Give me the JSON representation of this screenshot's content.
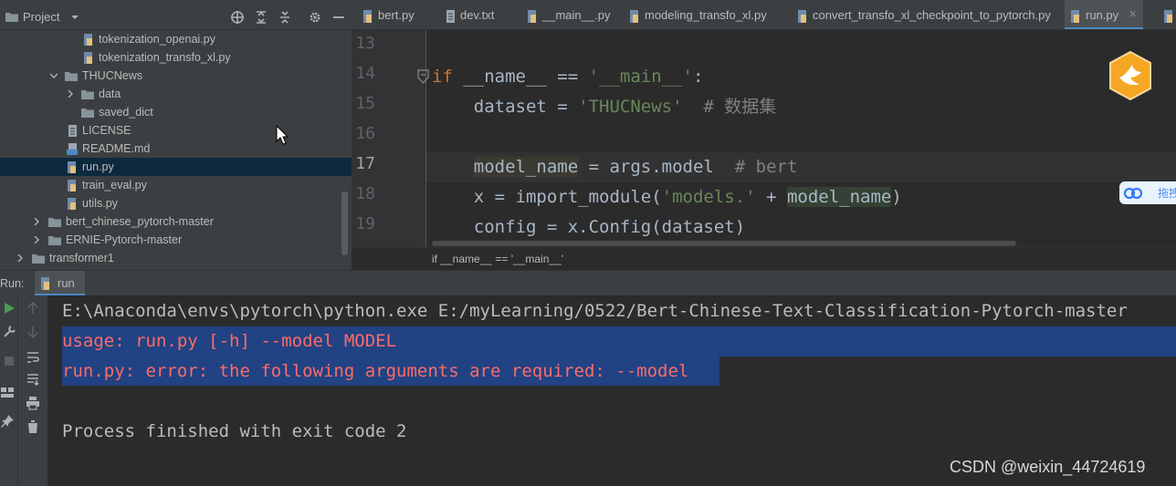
{
  "project": {
    "title": "Project",
    "tree": [
      {
        "label": "tokenization_openai.py",
        "icon": "python-file-icon",
        "selected": false
      },
      {
        "label": "tokenization_transfo_xl.py",
        "icon": "python-file-icon",
        "selected": false
      },
      {
        "label": "THUCNews",
        "icon": "folder-icon",
        "expanded": true
      },
      {
        "label": "data",
        "icon": "folder-icon",
        "expanded": false
      },
      {
        "label": "saved_dict",
        "icon": "folder-icon"
      },
      {
        "label": "LICENSE",
        "icon": "text-file-icon"
      },
      {
        "label": "README.md",
        "icon": "markdown-file-icon"
      },
      {
        "label": "run.py",
        "icon": "python-file-icon",
        "selected": true
      },
      {
        "label": "train_eval.py",
        "icon": "python-file-icon"
      },
      {
        "label": "utils.py",
        "icon": "python-file-icon"
      },
      {
        "label": "bert_chinese_pytorch-master",
        "icon": "folder-icon",
        "expanded": false
      },
      {
        "label": "ERNIE-Pytorch-master",
        "icon": "folder-icon",
        "expanded": false
      },
      {
        "label": "transformer1",
        "icon": "folder-icon",
        "expanded": false
      }
    ]
  },
  "tabs": [
    {
      "label": "bert.py",
      "icon": "python-file-icon",
      "active": false
    },
    {
      "label": "dev.txt",
      "icon": "text-file-icon",
      "active": false
    },
    {
      "label": "__main__.py",
      "icon": "python-file-icon",
      "active": false
    },
    {
      "label": "modeling_transfo_xl.py",
      "icon": "python-file-icon",
      "active": false
    },
    {
      "label": "convert_transfo_xl_checkpoint_to_pytorch.py",
      "icon": "python-file-icon",
      "active": false
    },
    {
      "label": "run.py",
      "icon": "python-file-icon",
      "active": true
    }
  ],
  "editor": {
    "line_numbers": [
      "13",
      "14",
      "15",
      "16",
      "17",
      "18",
      "19"
    ],
    "current_line": "17",
    "breadcrumb": "if __name__ == '__main__'",
    "side_widget_text": "拖拽"
  },
  "code": {
    "l14_kw": "if",
    "l14_a": " __name__ == ",
    "l14_str": "'__main__'",
    "l14_b": ":",
    "l15_a": "    dataset = ",
    "l15_str": "'THUCNews'",
    "l15_cmt": "  # 数据集",
    "l17_ident": "model_name",
    "l17_a": " = args.model  ",
    "l17_cmt": "# bert",
    "l18_a": "    x = import_module(",
    "l18_str": "'models.'",
    "l18_b": " + ",
    "l18_ident": "model_name",
    "l18_c": ")",
    "l19_a": "    config = x.Config(dataset)"
  },
  "run": {
    "label": "Run:",
    "tab_label": "run",
    "console": {
      "cmd": "E:\\Anaconda\\envs\\pytorch\\python.exe E:/myLearning/0522/Bert-Chinese-Text-Classification-Pytorch-master",
      "usage": "usage: run.py [-h] --model MODEL",
      "error": "run.py: error: the following arguments are required: --model",
      "finished": "Process finished with exit code 2"
    }
  },
  "watermark": "CSDN @weixin_44724619",
  "colors": {
    "accent": "#4a88c7",
    "selection": "#214283",
    "error_text": "#ff6b68",
    "keyword": "#cc7832",
    "string": "#6a8759",
    "comment": "#808080"
  }
}
